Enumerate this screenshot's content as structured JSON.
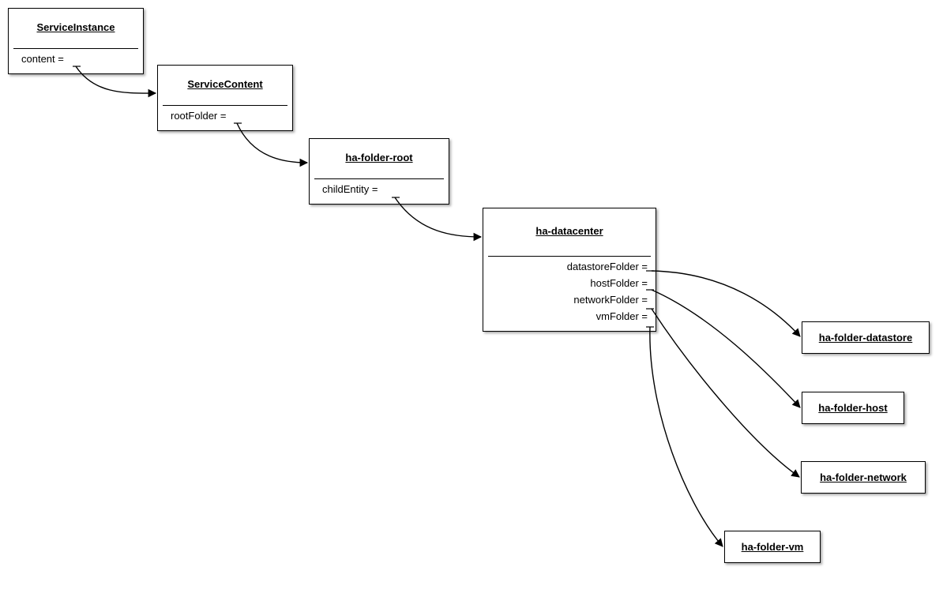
{
  "diagram": {
    "nodes": {
      "serviceInstance": {
        "title": "ServiceInstance",
        "props": {
          "content": "content  ="
        }
      },
      "serviceContent": {
        "title": "ServiceContent",
        "props": {
          "rootFolder": "rootFolder  ="
        }
      },
      "haFolderRoot": {
        "title": "ha-folder-root",
        "props": {
          "childEntity": "childEntity  ="
        }
      },
      "haDatacenter": {
        "title": "ha-datacenter",
        "props": {
          "datastoreFolder": "datastoreFolder  =",
          "hostFolder": "hostFolder  =",
          "networkFolder": "networkFolder  =",
          "vmFolder": "vmFolder  ="
        }
      },
      "haFolderDatastore": {
        "title": "ha-folder-datastore"
      },
      "haFolderHost": {
        "title": "ha-folder-host"
      },
      "haFolderNetwork": {
        "title": "ha-folder-network"
      },
      "haFolderVm": {
        "title": "ha-folder-vm"
      }
    }
  }
}
